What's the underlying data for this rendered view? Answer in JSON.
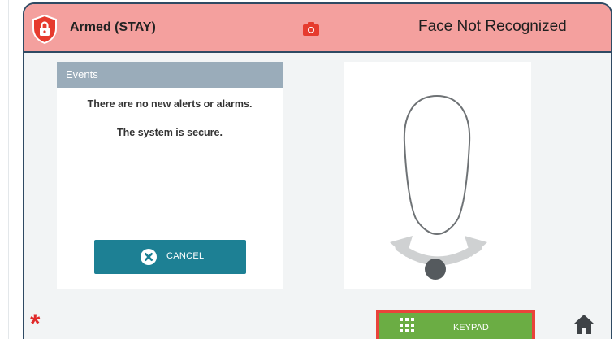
{
  "header": {
    "arm_status": "Armed (STAY)",
    "face_status": "Face Not Recognized",
    "shield_icon": "shield-lock-icon",
    "camera_icon": "camera-icon",
    "background_color": "#f4a09e"
  },
  "events": {
    "title": "Events",
    "message_line1": "There are no new alerts or alarms.",
    "message_line2": "The system is secure.",
    "cancel_label": "CANCEL",
    "cancel_icon": "close-circle-icon"
  },
  "face_panel": {
    "guide_icon": "face-outline-icon"
  },
  "footer": {
    "emergency_icon": "asterisk-icon",
    "emergency_symbol": "*",
    "keypad_label": "KEYPAD",
    "keypad_icon": "keypad-grid-icon",
    "home_icon": "home-icon"
  },
  "colors": {
    "accent_teal": "#1d8094",
    "keypad_green": "#6bad44",
    "alert_red": "#e9433a",
    "frame_border": "#2f4a63"
  }
}
